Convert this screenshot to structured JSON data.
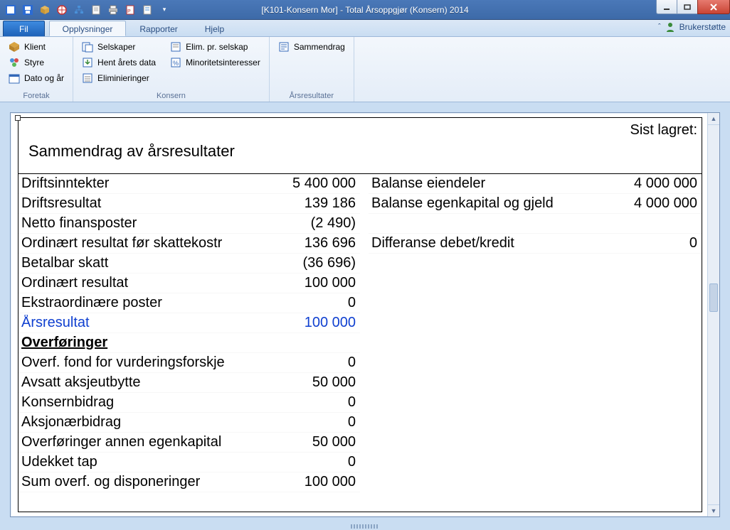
{
  "window": {
    "title": "[K101-Konsern Mor] - Total Årsoppgjør (Konsern) 2014"
  },
  "qat_icons": [
    "app",
    "save",
    "box",
    "globe",
    "tree",
    "page",
    "print",
    "pdf",
    "notes",
    "dropdown"
  ],
  "tabs": {
    "file": "Fil",
    "items": [
      "Opplysninger",
      "Rapporter",
      "Hjelp"
    ],
    "active": 0,
    "support": "Brukerstøtte"
  },
  "ribbon": {
    "groups": [
      {
        "label": "Foretak",
        "cols": [
          [
            {
              "icon": "client",
              "text": "Klient"
            },
            {
              "icon": "board",
              "text": "Styre"
            },
            {
              "icon": "date",
              "text": "Dato og år"
            }
          ]
        ]
      },
      {
        "label": "Konsern",
        "cols": [
          [
            {
              "icon": "companies",
              "text": "Selskaper"
            },
            {
              "icon": "fetch",
              "text": "Hent årets data"
            },
            {
              "icon": "elim",
              "text": "Eliminieringer"
            }
          ],
          [
            {
              "icon": "elimper",
              "text": "Elim. pr. selskap"
            },
            {
              "icon": "minority",
              "text": "Minoritetsinteresser"
            }
          ]
        ]
      },
      {
        "label": "Årsresultater",
        "cols": [
          [
            {
              "icon": "summary",
              "text": "Sammendrag"
            }
          ]
        ]
      }
    ]
  },
  "sheet": {
    "saved_label": "Sist lagret:",
    "title": "Sammendrag av årsresultater",
    "left": [
      {
        "label": "Driftsinntekter",
        "value": "5 400 000"
      },
      {
        "label": "Driftsresultat",
        "value": "139 186"
      },
      {
        "label": "Netto finansposter",
        "value": "(2 490)"
      },
      {
        "label": "Ordinært resultat før skattekostr",
        "value": "136 696"
      },
      {
        "label": "Betalbar skatt",
        "value": "(36 696)"
      },
      {
        "label": "Ordinært resultat",
        "value": "100 000"
      },
      {
        "label": "Ekstraordinære poster",
        "value": "0"
      },
      {
        "label": "Årsresultat",
        "value": "100 000",
        "style": "blue"
      },
      {
        "label": "Overføringer",
        "value": "",
        "style": "heading"
      },
      {
        "label": "Overf. fond for vurderingsforskje",
        "value": "0"
      },
      {
        "label": "Avsatt aksjeutbytte",
        "value": "50 000"
      },
      {
        "label": "Konsernbidrag",
        "value": "0"
      },
      {
        "label": "Aksjonærbidrag",
        "value": "0"
      },
      {
        "label": "Overføringer annen egenkapital",
        "value": "50 000"
      },
      {
        "label": "Udekket tap",
        "value": "0"
      },
      {
        "label": "Sum overf. og disponeringer",
        "value": "100 000"
      }
    ],
    "right": [
      {
        "label": "Balanse eiendeler",
        "value": "4 000 000"
      },
      {
        "label": "Balanse egenkapital og gjeld",
        "value": "4 000 000"
      },
      {
        "label": "",
        "value": ""
      },
      {
        "label": "Differanse debet/kredit",
        "value": "0"
      }
    ]
  }
}
